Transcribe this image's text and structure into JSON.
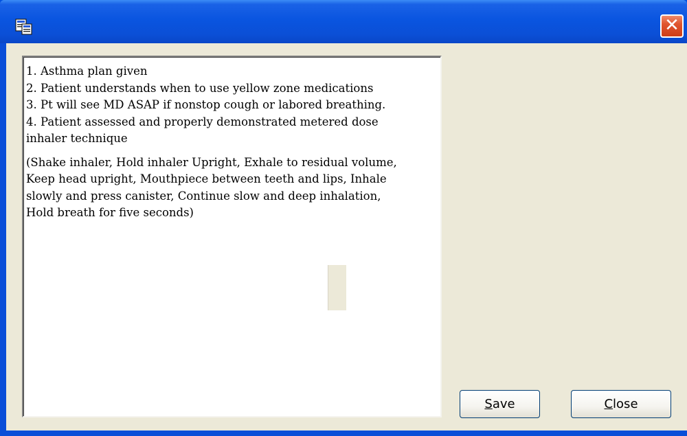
{
  "window": {
    "title": "",
    "app_icon": "notes-window-icon",
    "close_glyph": "✕"
  },
  "notes": {
    "lines": [
      "1. Asthma plan given",
      "2. Patient understands when to use yellow zone medications",
      "3. Pt will see MD ASAP if nonstop cough or labored breathing.",
      "4. Patient assessed and properly demonstrated metered dose",
      "inhaler technique"
    ],
    "paragraph": [
      "(Shake inhaler, Hold inhaler Upright, Exhale to residual volume,",
      "Keep head upright, Mouthpiece between teeth and lips, Inhale",
      "slowly and press canister, Continue slow and deep inhalation,",
      "Hold breath for five seconds)"
    ]
  },
  "buttons": {
    "save": {
      "accel": "S",
      "rest": "ave"
    },
    "close": {
      "accel": "C",
      "rest": "lose"
    }
  },
  "colors": {
    "titlebar": "#0a55e0",
    "client_bg": "#ece9d8",
    "close_red": "#e0552e"
  }
}
